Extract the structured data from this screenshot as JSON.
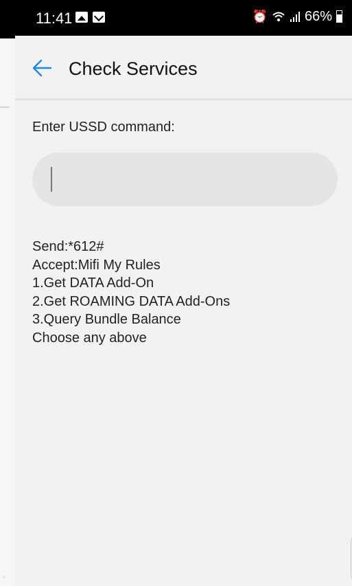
{
  "status_bar": {
    "time": "11:41",
    "battery_text": "66%",
    "battery_level": 0.66,
    "icons": [
      "gallery-icon",
      "mail-icon",
      "alarm-icon",
      "wifi-icon",
      "signal-icon",
      "battery-icon"
    ]
  },
  "header": {
    "title": "Check Services",
    "back_icon": "arrow-left-icon",
    "accent_color": "#1e88e5"
  },
  "form": {
    "label": "Enter USSD command:",
    "input_value": "",
    "input_placeholder": ""
  },
  "response": {
    "lines": [
      "Send:*612#",
      "Accept:Mifi My Rules",
      "1.Get DATA Add-On",
      "2.Get ROAMING DATA Add-Ons",
      "3.Query Bundle Balance",
      "Choose any above"
    ]
  }
}
